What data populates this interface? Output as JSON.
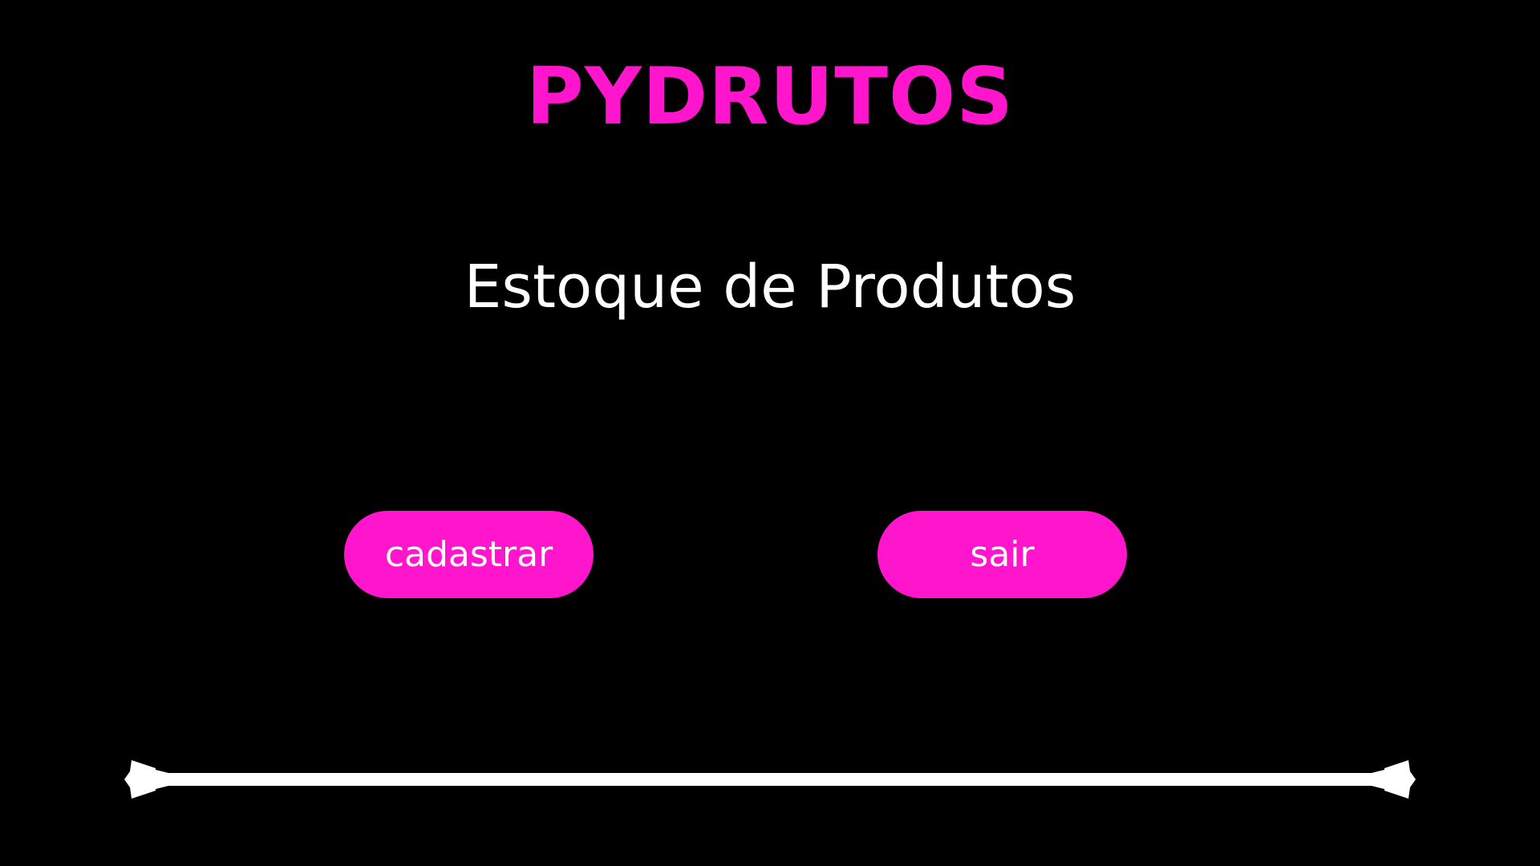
{
  "header": {
    "brand": "PYDRUTOS",
    "subtitle": "Estoque de Produtos"
  },
  "actions": {
    "register_label": "cadastrar",
    "exit_label": "sair"
  },
  "theme": {
    "background": "#000000",
    "accent": "#ff16cc",
    "text": "#ffffff"
  },
  "decor": {
    "divider_icon": "ornamental-line-divider"
  }
}
